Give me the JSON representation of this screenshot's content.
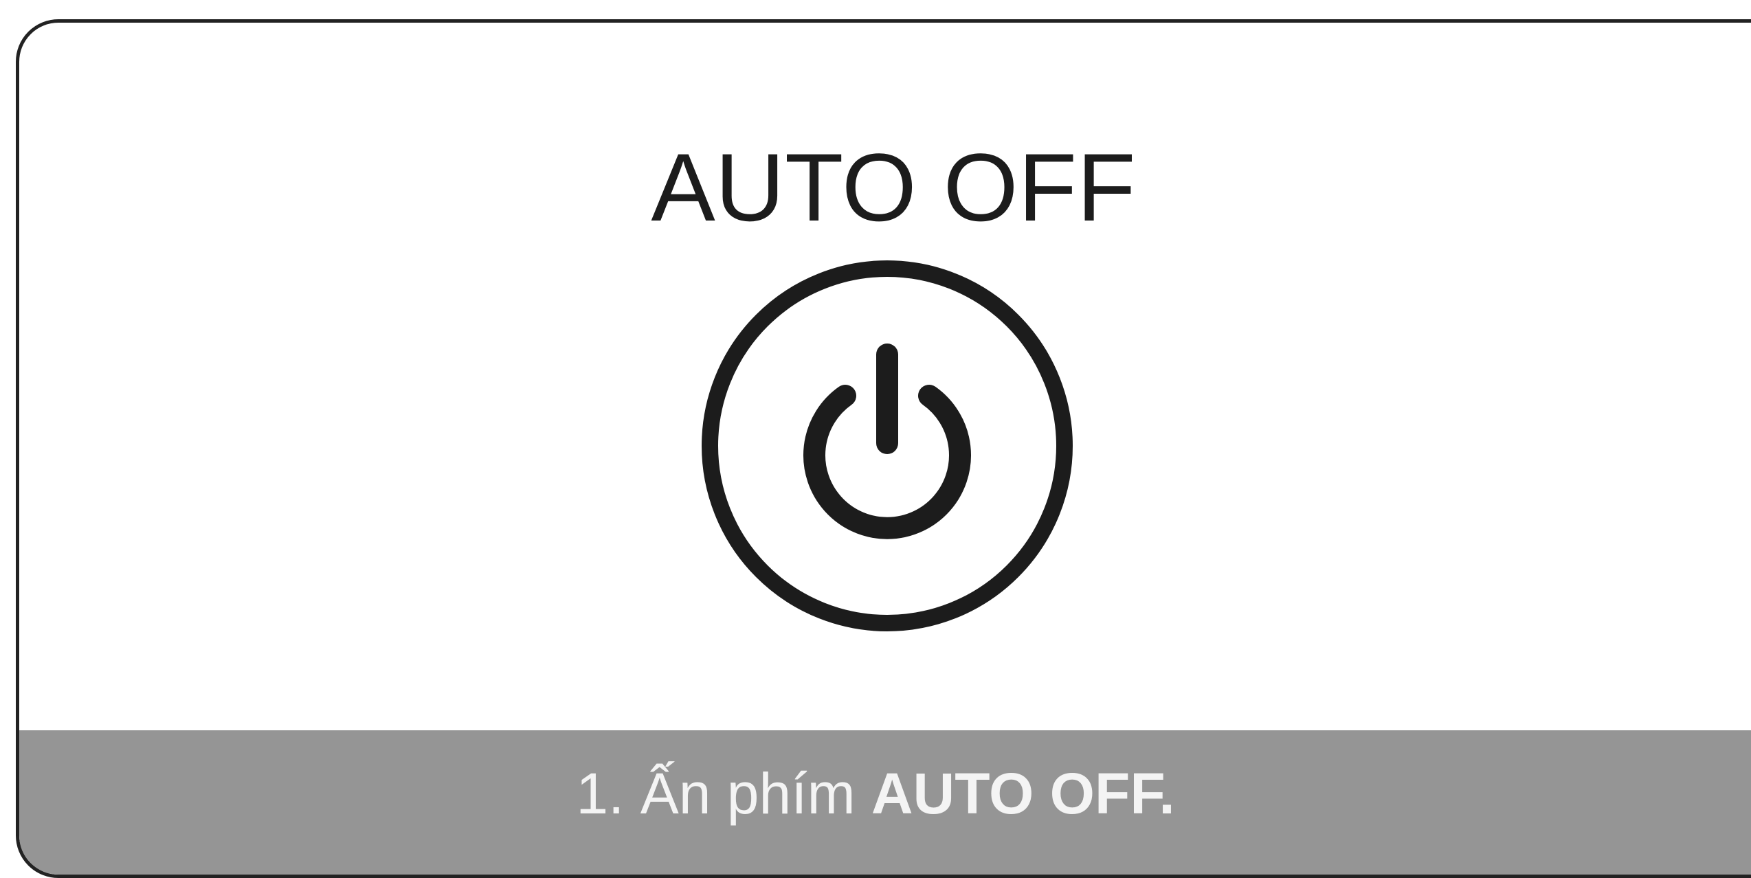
{
  "panel": {
    "title": "AUTO OFF",
    "button_icon": "power-icon"
  },
  "caption": {
    "prefix": "1. Ấn phím ",
    "key_label": "AUTO OFF."
  },
  "colors": {
    "border": "#222222",
    "icon": "#1c1c1c",
    "caption_bar": "#959595",
    "caption_text": "#f4f4f4",
    "background": "#ffffff"
  }
}
